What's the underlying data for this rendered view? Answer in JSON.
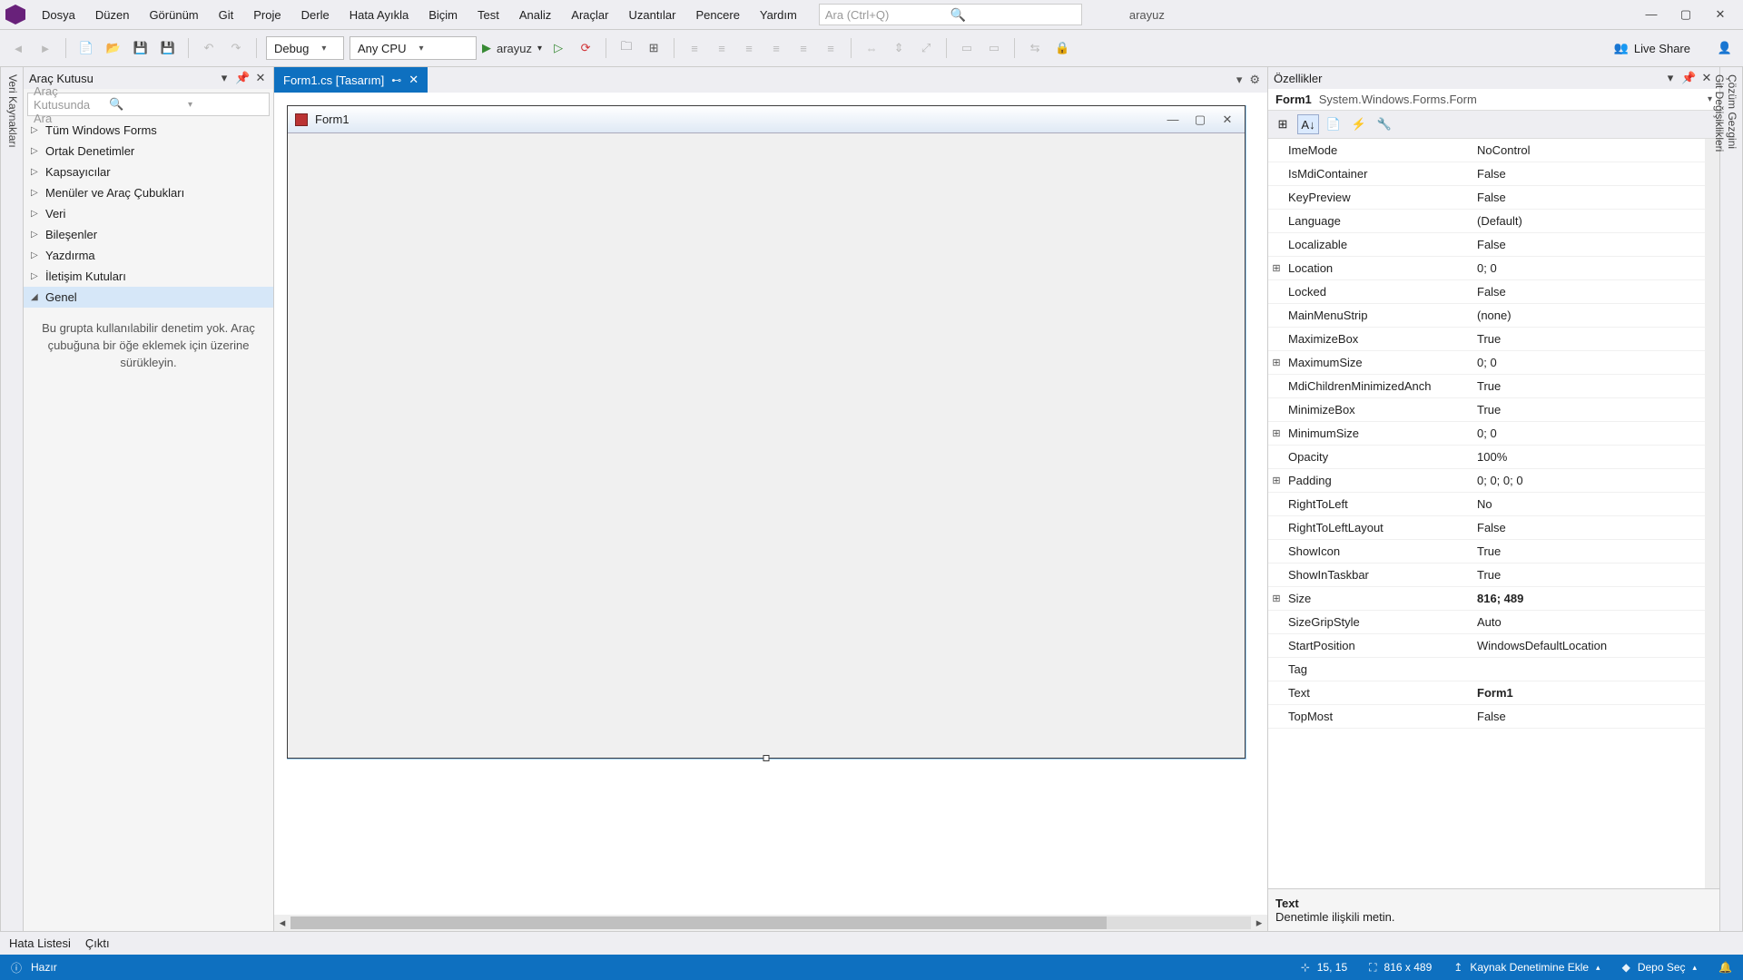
{
  "menu": {
    "items": [
      "Dosya",
      "Düzen",
      "Görünüm",
      "Git",
      "Proje",
      "Derle",
      "Hata Ayıkla",
      "Biçim",
      "Test",
      "Analiz",
      "Araçlar",
      "Uzantılar",
      "Pencere",
      "Yardım"
    ],
    "search_placeholder": "Ara (Ctrl+Q)",
    "solution": "arayuz"
  },
  "toolbar": {
    "config": "Debug",
    "platform": "Any CPU",
    "start_label": "arayuz",
    "liveshare": "Live Share"
  },
  "toolbox": {
    "title": "Araç Kutusu",
    "search_placeholder": "Araç Kutusunda Ara",
    "groups": [
      {
        "label": "Tüm Windows Forms",
        "expanded": false,
        "selected": false
      },
      {
        "label": "Ortak Denetimler",
        "expanded": false,
        "selected": false
      },
      {
        "label": "Kapsayıcılar",
        "expanded": false,
        "selected": false
      },
      {
        "label": "Menüler ve Araç Çubukları",
        "expanded": false,
        "selected": false
      },
      {
        "label": "Veri",
        "expanded": false,
        "selected": false
      },
      {
        "label": "Bileşenler",
        "expanded": false,
        "selected": false
      },
      {
        "label": "Yazdırma",
        "expanded": false,
        "selected": false
      },
      {
        "label": "İletişim Kutuları",
        "expanded": false,
        "selected": false
      },
      {
        "label": "Genel",
        "expanded": true,
        "selected": true
      }
    ],
    "hint": "Bu grupta kullanılabilir denetim yok. Araç çubuğuna bir öğe eklemek için üzerine sürükleyin."
  },
  "tab": {
    "label": "Form1.cs [Tasarım]"
  },
  "form": {
    "title": "Form1"
  },
  "properties": {
    "title": "Özellikler",
    "object_name": "Form1",
    "object_type": "System.Windows.Forms.Form",
    "rows": [
      {
        "expand": "",
        "name": "ImeMode",
        "value": "NoControl"
      },
      {
        "expand": "",
        "name": "IsMdiContainer",
        "value": "False"
      },
      {
        "expand": "",
        "name": "KeyPreview",
        "value": "False"
      },
      {
        "expand": "",
        "name": "Language",
        "value": "(Default)"
      },
      {
        "expand": "",
        "name": "Localizable",
        "value": "False"
      },
      {
        "expand": "⊞",
        "name": "Location",
        "value": "0; 0"
      },
      {
        "expand": "",
        "name": "Locked",
        "value": "False"
      },
      {
        "expand": "",
        "name": "MainMenuStrip",
        "value": "(none)"
      },
      {
        "expand": "",
        "name": "MaximizeBox",
        "value": "True"
      },
      {
        "expand": "⊞",
        "name": "MaximumSize",
        "value": "0; 0"
      },
      {
        "expand": "",
        "name": "MdiChildrenMinimizedAnch",
        "value": "True"
      },
      {
        "expand": "",
        "name": "MinimizeBox",
        "value": "True"
      },
      {
        "expand": "⊞",
        "name": "MinimumSize",
        "value": "0; 0"
      },
      {
        "expand": "",
        "name": "Opacity",
        "value": "100%"
      },
      {
        "expand": "⊞",
        "name": "Padding",
        "value": "0; 0; 0; 0"
      },
      {
        "expand": "",
        "name": "RightToLeft",
        "value": "No"
      },
      {
        "expand": "",
        "name": "RightToLeftLayout",
        "value": "False"
      },
      {
        "expand": "",
        "name": "ShowIcon",
        "value": "True"
      },
      {
        "expand": "",
        "name": "ShowInTaskbar",
        "value": "True"
      },
      {
        "expand": "⊞",
        "name": "Size",
        "value": "816; 489",
        "bold": true
      },
      {
        "expand": "",
        "name": "SizeGripStyle",
        "value": "Auto"
      },
      {
        "expand": "",
        "name": "StartPosition",
        "value": "WindowsDefaultLocation"
      },
      {
        "expand": "",
        "name": "Tag",
        "value": ""
      },
      {
        "expand": "",
        "name": "Text",
        "value": "Form1",
        "bold": true
      },
      {
        "expand": "",
        "name": "TopMost",
        "value": "False"
      }
    ],
    "help_name": "Text",
    "help_desc": "Denetimle ilişkili metin."
  },
  "bottom_tabs": [
    "Hata Listesi",
    "Çıktı"
  ],
  "status": {
    "ready": "Hazır",
    "pos": "15, 15",
    "size": "816 x 489",
    "source_control": "Kaynak Denetimine Ekle",
    "repo": "Depo Seç"
  },
  "side_left_label": "Veri Kaynakları",
  "side_right_labels": [
    "Çözüm Gezgini",
    "Git Değişiklikleri"
  ]
}
